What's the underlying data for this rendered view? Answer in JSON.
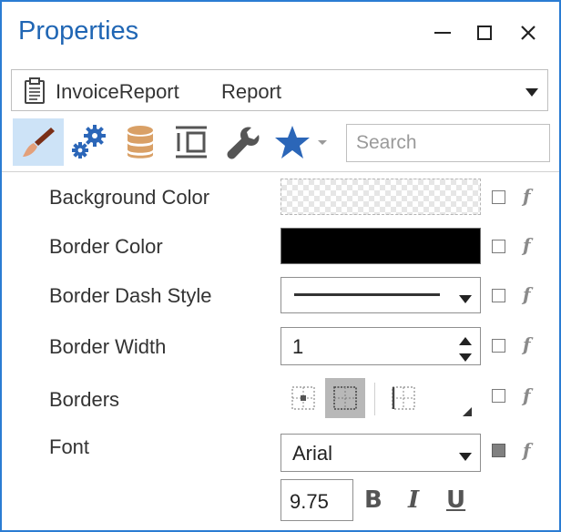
{
  "window": {
    "title": "Properties",
    "controls": {
      "minimize": "—",
      "maximize": "□",
      "close": "✕"
    }
  },
  "object_selector": {
    "name": "InvoiceReport",
    "type": "Report",
    "icon": "clipboard-icon"
  },
  "toolbar": {
    "tabs": [
      {
        "icon": "brush-icon",
        "active": true
      },
      {
        "icon": "gears-icon",
        "active": false
      },
      {
        "icon": "database-icon",
        "active": false
      },
      {
        "icon": "layout-icon",
        "active": false
      },
      {
        "icon": "wrench-icon",
        "active": false
      },
      {
        "icon": "star-icon",
        "active": false
      }
    ],
    "search_placeholder": "Search"
  },
  "properties": [
    {
      "label": "Background Color",
      "value": "",
      "editor": "color",
      "color": "transparent"
    },
    {
      "label": "Border Color",
      "value": "",
      "editor": "color",
      "color": "#000000"
    },
    {
      "label": "Border Dash Style",
      "value": "",
      "editor": "dash-select"
    },
    {
      "label": "Border Width",
      "value": "1",
      "editor": "spin"
    },
    {
      "label": "Borders",
      "value": "",
      "editor": "borders"
    },
    {
      "label": "Font",
      "value": "Arial",
      "editor": "font"
    }
  ],
  "font": {
    "size": "9.75",
    "bold": "B",
    "italic": "I",
    "underline": "U"
  },
  "expression_marker": "f",
  "colors": {
    "accent": "#2b7cd3",
    "title": "#2066b4",
    "active_tab": "#cde3f7"
  }
}
